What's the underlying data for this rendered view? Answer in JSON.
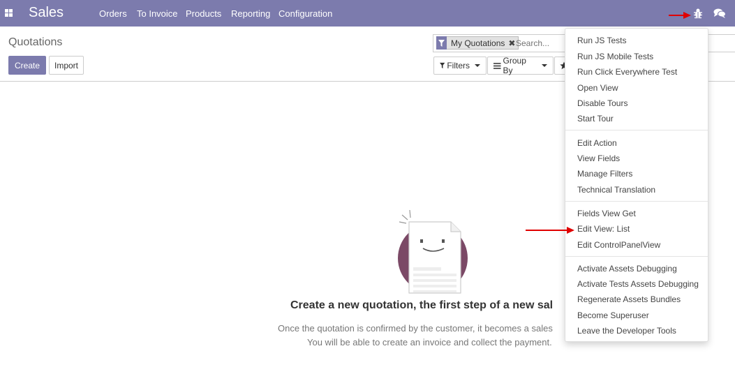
{
  "navbar": {
    "brand": "Sales",
    "menu": [
      "Orders",
      "To Invoice",
      "Products",
      "Reporting",
      "Configuration"
    ],
    "icons": [
      "apps-icon",
      "bug-icon",
      "chat-icon"
    ],
    "color": "#7c7bad"
  },
  "control_panel": {
    "title": "Quotations",
    "create_label": "Create",
    "import_label": "Import",
    "facet_label": "My Quotations",
    "search_placeholder": "Search...",
    "filters_label": "Filters",
    "groupby_label": "Group By"
  },
  "helper": {
    "title": "Create a new quotation, the first step of a new sal",
    "line1": "Once the quotation is confirmed by the customer, it becomes a sales",
    "line2": "You will be able to create an invoice and collect the payment."
  },
  "debug_menu": {
    "groups": [
      [
        "Run JS Tests",
        "Run JS Mobile Tests",
        "Run Click Everywhere Test",
        "Open View",
        "Disable Tours",
        "Start Tour"
      ],
      [
        "Edit Action",
        "View Fields",
        "Manage Filters",
        "Technical Translation"
      ],
      [
        "Fields View Get",
        "Edit View: List",
        "Edit ControlPanelView"
      ],
      [
        "Activate Assets Debugging",
        "Activate Tests Assets Debugging",
        "Regenerate Assets Bundles",
        "Become Superuser",
        "Leave the Developer Tools"
      ]
    ]
  },
  "annotation_color": "#e00000"
}
